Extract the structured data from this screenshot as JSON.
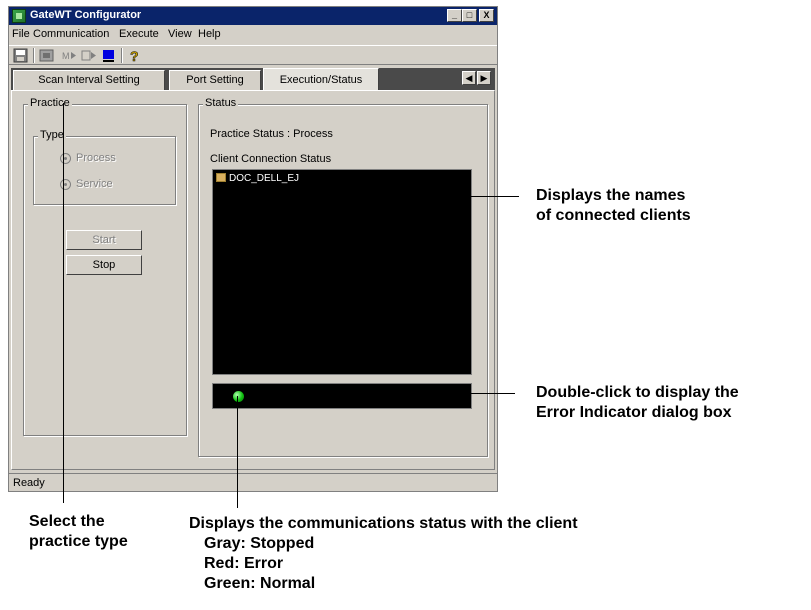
{
  "window": {
    "title": "GateWT Configurator",
    "controls": [
      "_",
      "□",
      "X"
    ]
  },
  "menu": [
    "File",
    "Communication",
    "Execute",
    "View",
    "Help"
  ],
  "toolbar": [
    "save-icon",
    "settings-icon",
    "connect-icon",
    "run-icon",
    "stop-icon",
    "help-icon"
  ],
  "tabs": {
    "items": [
      "Scan Interval Setting",
      "Port Setting",
      "Execution/Status"
    ],
    "active": "Execution/Status"
  },
  "practice": {
    "title": "Practice",
    "type_title": "Type",
    "options": [
      "Process",
      "Service"
    ],
    "start_label": "Start",
    "stop_label": "Stop"
  },
  "status": {
    "title": "Status",
    "practice_status": "Practice Status : Process",
    "client_connection_label": "Client Connection Status",
    "clients": [
      "DOC_DELL_EJ"
    ],
    "indicator_color": "#10c010"
  },
  "statusbar": {
    "text": "Ready"
  },
  "callouts": {
    "clients_line1": "Displays the names",
    "clients_line2": "of connected clients",
    "error_line1": "Double-click to display the",
    "error_line2": "Error Indicator dialog box",
    "practice_line1": "Select the",
    "practice_line2": "practice type",
    "comm_line1": "Displays the communications status with the client",
    "comm_line2": "Gray: Stopped",
    "comm_line3": "Red: Error",
    "comm_line4": "Green: Normal"
  }
}
